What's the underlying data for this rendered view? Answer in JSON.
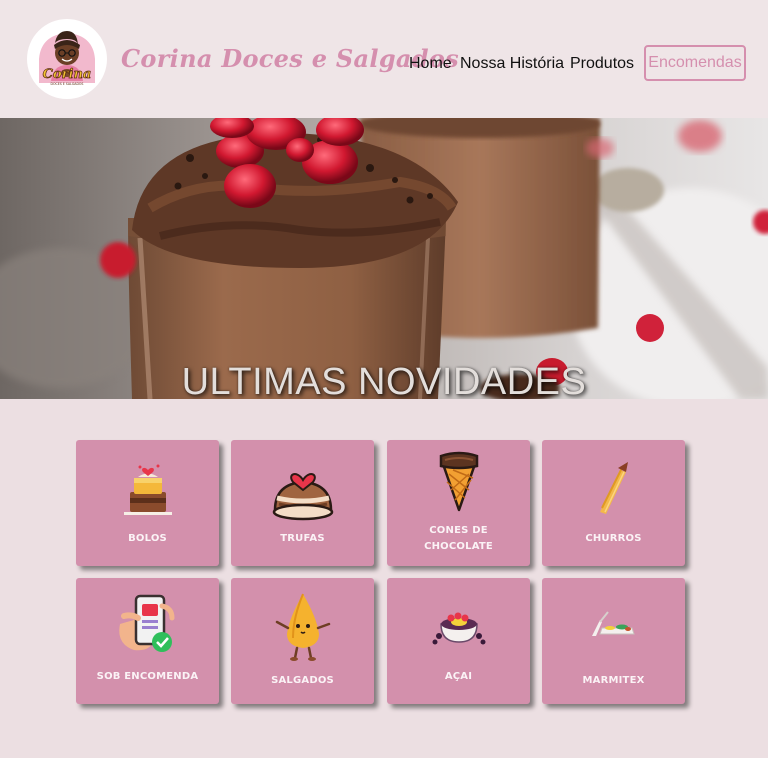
{
  "header": {
    "brand": "Corina Doces e Salgados",
    "logo_text": "Corina",
    "logo_subtext": "DOCES E SALGADOS",
    "nav": {
      "home": "Home",
      "history": "Nossa História",
      "products": "Produtos"
    },
    "order_button": "Encomendas"
  },
  "hero": {
    "title": "ULTIMAS NOVIDADES"
  },
  "categories": [
    {
      "label": "BOLOS",
      "icon": "cake-icon"
    },
    {
      "label": "TRUFAS",
      "icon": "truffle-icon"
    },
    {
      "label": "CONES DE CHOCOLATE",
      "icon": "chocolate-cone-icon"
    },
    {
      "label": "CHURROS",
      "icon": "churro-icon"
    },
    {
      "label": "SOB ENCOMENDA",
      "icon": "phone-order-icon"
    },
    {
      "label": "SALGADOS",
      "icon": "coxinha-icon"
    },
    {
      "label": "AÇAI",
      "icon": "acai-bowl-icon"
    },
    {
      "label": "MARMITEX",
      "icon": "lunchbox-icon"
    }
  ],
  "colors": {
    "accent": "#d58fae",
    "card": "#d390ac",
    "page_bg": "#ecdfe2",
    "header_bg": "#efe5e7"
  }
}
